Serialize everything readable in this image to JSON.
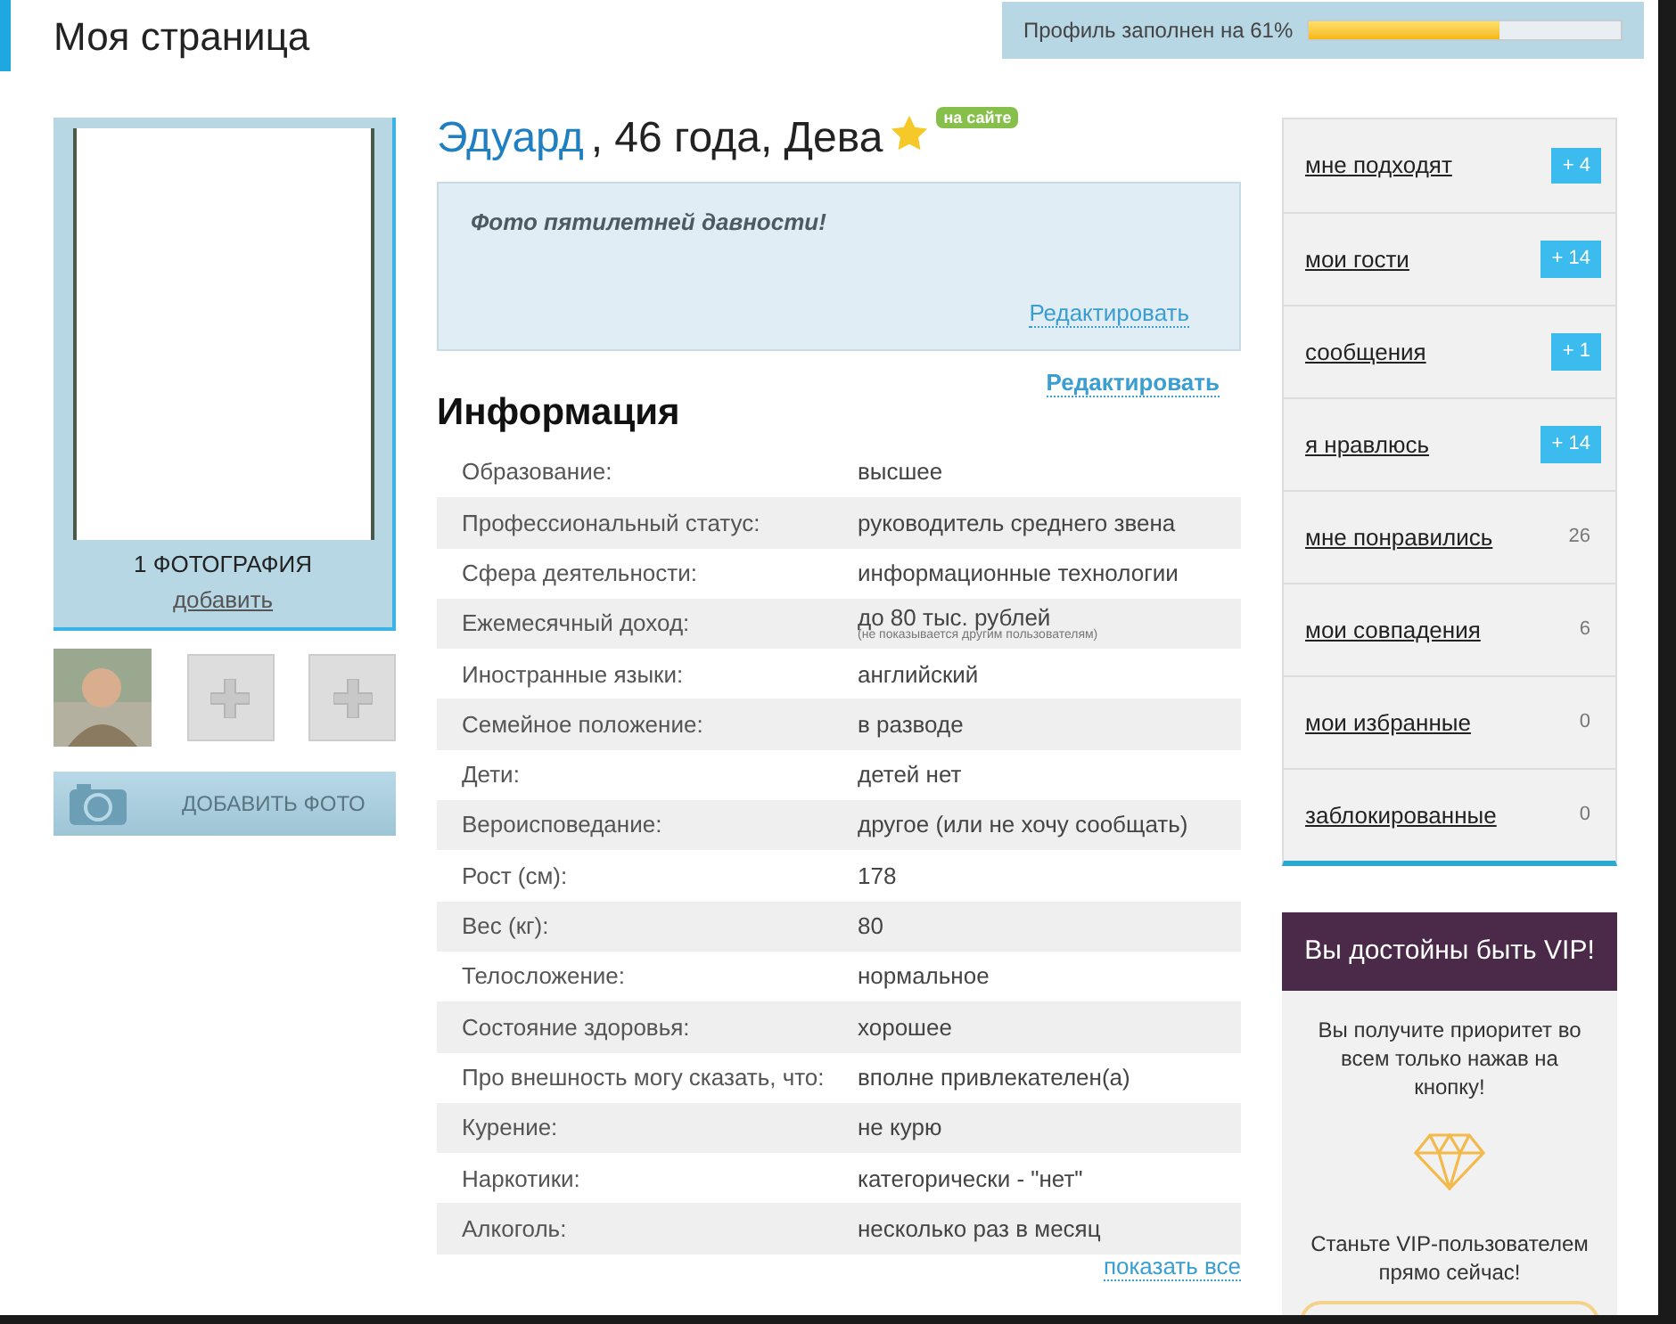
{
  "header": {
    "title": "Моя страница",
    "profile_progress": {
      "label": "Профиль заполнен на 61%",
      "level": 0.61
    }
  },
  "photos": {
    "count_label": "1 ФОТОГРАФИЯ",
    "add_link": "добавить",
    "add_photo_button": "ДОБАВИТЬ ФОТО"
  },
  "profile": {
    "name": "Эдуард",
    "details": ", 46 года, Дева",
    "online_badge": "на сайте",
    "about": "Фото пятилетней давности!",
    "about_edit": "Редактировать",
    "info_edit": "Редактировать"
  },
  "info": {
    "title": "Информация",
    "rows": [
      {
        "label": "Образование:",
        "value": "высшее"
      },
      {
        "label": "Профессиональный статус:",
        "value": "руководитель среднего звена"
      },
      {
        "label": "Сфера деятельности:",
        "value": "информационные технологии"
      },
      {
        "label": "Ежемесячный доход:",
        "value": "до 80 тыс. рублей",
        "note": "(не показывается другим пользователям)"
      },
      {
        "label": "Иностранные языки:",
        "value": "английский"
      },
      {
        "label": "Семейное положение:",
        "value": "в разводе"
      },
      {
        "label": "Дети:",
        "value": "детей нет"
      },
      {
        "label": "Вероисповедание:",
        "value": "другое (или не хочу сообщать)"
      },
      {
        "label": "Рост (см):",
        "value": "178"
      },
      {
        "label": "Вес (кг):",
        "value": "80"
      },
      {
        "label": "Телосложение:",
        "value": "нормальное"
      },
      {
        "label": "Состояние здоровья:",
        "value": "хорошее"
      },
      {
        "label": "Про внешность могу сказать, что:",
        "value": "вполне привлекателен(а)"
      },
      {
        "label": "Курение:",
        "value": "не курю"
      },
      {
        "label": "Наркотики:",
        "value": "категорически - \"нет\""
      },
      {
        "label": "Алкоголь:",
        "value": "несколько раз в месяц"
      }
    ],
    "show_all": "показать все"
  },
  "sidebar": {
    "items": [
      {
        "label": "мне подходят",
        "count": "+ 4",
        "kind": "new"
      },
      {
        "label": "мои гости",
        "count": "+ 14",
        "kind": "new"
      },
      {
        "label": "сообщения",
        "count": "+ 1",
        "kind": "new"
      },
      {
        "label": "я нравлюсь",
        "count": "+ 14",
        "kind": "new"
      },
      {
        "label": "мне понравились",
        "count": "26",
        "kind": "total"
      },
      {
        "label": "мои совпадения",
        "count": "6",
        "kind": "total"
      },
      {
        "label": "мои избранные",
        "count": "0",
        "kind": "total"
      },
      {
        "label": "заблокированные",
        "count": "0",
        "kind": "total"
      }
    ]
  },
  "vip": {
    "title": "Вы достойны быть VIP!",
    "text": "Вы получите приоритет во всем только нажав на кнопку!",
    "cta_text": "Станьте VIP-пользователем прямо сейчас!"
  }
}
